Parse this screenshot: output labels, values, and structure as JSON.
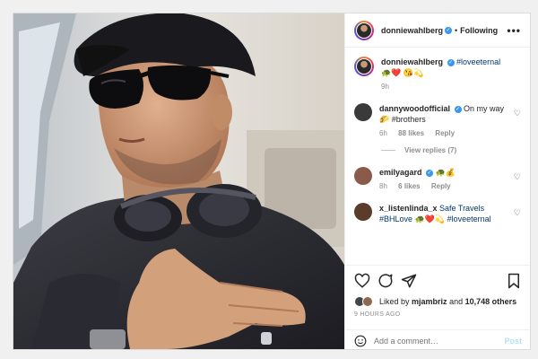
{
  "post": {
    "author": "donniewahlberg",
    "follow_state": "Following",
    "more_glyph": "•••"
  },
  "caption": {
    "author": "donniewahlberg",
    "text": "#loveeternal 🐢❤️ 😘💫",
    "time": "9h"
  },
  "comments": [
    {
      "user": "dannywoodofficial",
      "verified": true,
      "text": "On my way 🌮 #brothers",
      "time": "6h",
      "likes": "88 likes",
      "reply": "Reply",
      "avatar_color": "#3a3a3a"
    },
    {
      "user": "emilyagard",
      "verified": true,
      "text": "🐢💰",
      "time": "8h",
      "likes": "6 likes",
      "reply": "Reply",
      "avatar_color": "#8a5a4a"
    },
    {
      "user": "x_listenlinda_x",
      "verified": false,
      "text": "Safe Travels #BHLove 🐢❤️💫 #loveeternal",
      "time": "",
      "likes": "",
      "reply": "",
      "avatar_color": "#5b3b2b"
    }
  ],
  "view_replies": "View replies (7)",
  "likes": {
    "prefix": "Liked by",
    "user": "mjambriz",
    "joiner": "and",
    "count": "10,748 others"
  },
  "time_ago": "9 HOURS AGO",
  "add_comment": {
    "placeholder": "Add a comment…",
    "post_label": "Post"
  },
  "icons": [
    "heart-icon",
    "comment-icon",
    "share-icon",
    "bookmark-icon",
    "emoji-icon",
    "more-icon"
  ],
  "colors": {
    "verified": "#3897f0",
    "hashtag": "#00376b",
    "muted": "#8e8e8e",
    "post_disabled": "#b2dffc"
  }
}
